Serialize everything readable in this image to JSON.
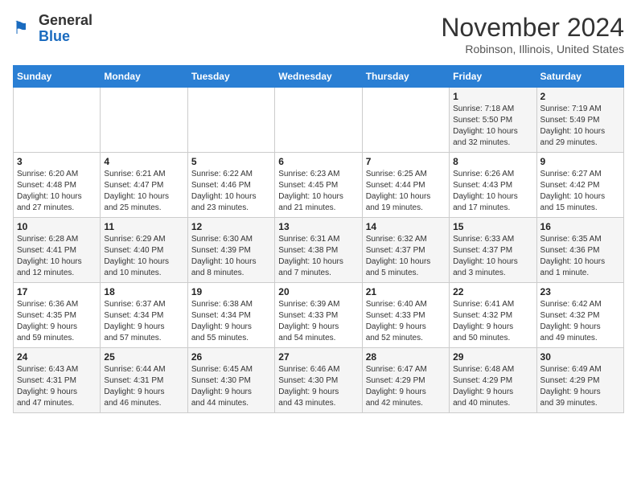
{
  "logo": {
    "general": "General",
    "blue": "Blue"
  },
  "title": "November 2024",
  "location": "Robinson, Illinois, United States",
  "days_of_week": [
    "Sunday",
    "Monday",
    "Tuesday",
    "Wednesday",
    "Thursday",
    "Friday",
    "Saturday"
  ],
  "weeks": [
    [
      {
        "day": "",
        "info": ""
      },
      {
        "day": "",
        "info": ""
      },
      {
        "day": "",
        "info": ""
      },
      {
        "day": "",
        "info": ""
      },
      {
        "day": "",
        "info": ""
      },
      {
        "day": "1",
        "info": "Sunrise: 7:18 AM\nSunset: 5:50 PM\nDaylight: 10 hours\nand 32 minutes."
      },
      {
        "day": "2",
        "info": "Sunrise: 7:19 AM\nSunset: 5:49 PM\nDaylight: 10 hours\nand 29 minutes."
      }
    ],
    [
      {
        "day": "3",
        "info": "Sunrise: 6:20 AM\nSunset: 4:48 PM\nDaylight: 10 hours\nand 27 minutes."
      },
      {
        "day": "4",
        "info": "Sunrise: 6:21 AM\nSunset: 4:47 PM\nDaylight: 10 hours\nand 25 minutes."
      },
      {
        "day": "5",
        "info": "Sunrise: 6:22 AM\nSunset: 4:46 PM\nDaylight: 10 hours\nand 23 minutes."
      },
      {
        "day": "6",
        "info": "Sunrise: 6:23 AM\nSunset: 4:45 PM\nDaylight: 10 hours\nand 21 minutes."
      },
      {
        "day": "7",
        "info": "Sunrise: 6:25 AM\nSunset: 4:44 PM\nDaylight: 10 hours\nand 19 minutes."
      },
      {
        "day": "8",
        "info": "Sunrise: 6:26 AM\nSunset: 4:43 PM\nDaylight: 10 hours\nand 17 minutes."
      },
      {
        "day": "9",
        "info": "Sunrise: 6:27 AM\nSunset: 4:42 PM\nDaylight: 10 hours\nand 15 minutes."
      }
    ],
    [
      {
        "day": "10",
        "info": "Sunrise: 6:28 AM\nSunset: 4:41 PM\nDaylight: 10 hours\nand 12 minutes."
      },
      {
        "day": "11",
        "info": "Sunrise: 6:29 AM\nSunset: 4:40 PM\nDaylight: 10 hours\nand 10 minutes."
      },
      {
        "day": "12",
        "info": "Sunrise: 6:30 AM\nSunset: 4:39 PM\nDaylight: 10 hours\nand 8 minutes."
      },
      {
        "day": "13",
        "info": "Sunrise: 6:31 AM\nSunset: 4:38 PM\nDaylight: 10 hours\nand 7 minutes."
      },
      {
        "day": "14",
        "info": "Sunrise: 6:32 AM\nSunset: 4:37 PM\nDaylight: 10 hours\nand 5 minutes."
      },
      {
        "day": "15",
        "info": "Sunrise: 6:33 AM\nSunset: 4:37 PM\nDaylight: 10 hours\nand 3 minutes."
      },
      {
        "day": "16",
        "info": "Sunrise: 6:35 AM\nSunset: 4:36 PM\nDaylight: 10 hours\nand 1 minute."
      }
    ],
    [
      {
        "day": "17",
        "info": "Sunrise: 6:36 AM\nSunset: 4:35 PM\nDaylight: 9 hours\nand 59 minutes."
      },
      {
        "day": "18",
        "info": "Sunrise: 6:37 AM\nSunset: 4:34 PM\nDaylight: 9 hours\nand 57 minutes."
      },
      {
        "day": "19",
        "info": "Sunrise: 6:38 AM\nSunset: 4:34 PM\nDaylight: 9 hours\nand 55 minutes."
      },
      {
        "day": "20",
        "info": "Sunrise: 6:39 AM\nSunset: 4:33 PM\nDaylight: 9 hours\nand 54 minutes."
      },
      {
        "day": "21",
        "info": "Sunrise: 6:40 AM\nSunset: 4:33 PM\nDaylight: 9 hours\nand 52 minutes."
      },
      {
        "day": "22",
        "info": "Sunrise: 6:41 AM\nSunset: 4:32 PM\nDaylight: 9 hours\nand 50 minutes."
      },
      {
        "day": "23",
        "info": "Sunrise: 6:42 AM\nSunset: 4:32 PM\nDaylight: 9 hours\nand 49 minutes."
      }
    ],
    [
      {
        "day": "24",
        "info": "Sunrise: 6:43 AM\nSunset: 4:31 PM\nDaylight: 9 hours\nand 47 minutes."
      },
      {
        "day": "25",
        "info": "Sunrise: 6:44 AM\nSunset: 4:31 PM\nDaylight: 9 hours\nand 46 minutes."
      },
      {
        "day": "26",
        "info": "Sunrise: 6:45 AM\nSunset: 4:30 PM\nDaylight: 9 hours\nand 44 minutes."
      },
      {
        "day": "27",
        "info": "Sunrise: 6:46 AM\nSunset: 4:30 PM\nDaylight: 9 hours\nand 43 minutes."
      },
      {
        "day": "28",
        "info": "Sunrise: 6:47 AM\nSunset: 4:29 PM\nDaylight: 9 hours\nand 42 minutes."
      },
      {
        "day": "29",
        "info": "Sunrise: 6:48 AM\nSunset: 4:29 PM\nDaylight: 9 hours\nand 40 minutes."
      },
      {
        "day": "30",
        "info": "Sunrise: 6:49 AM\nSunset: 4:29 PM\nDaylight: 9 hours\nand 39 minutes."
      }
    ]
  ]
}
